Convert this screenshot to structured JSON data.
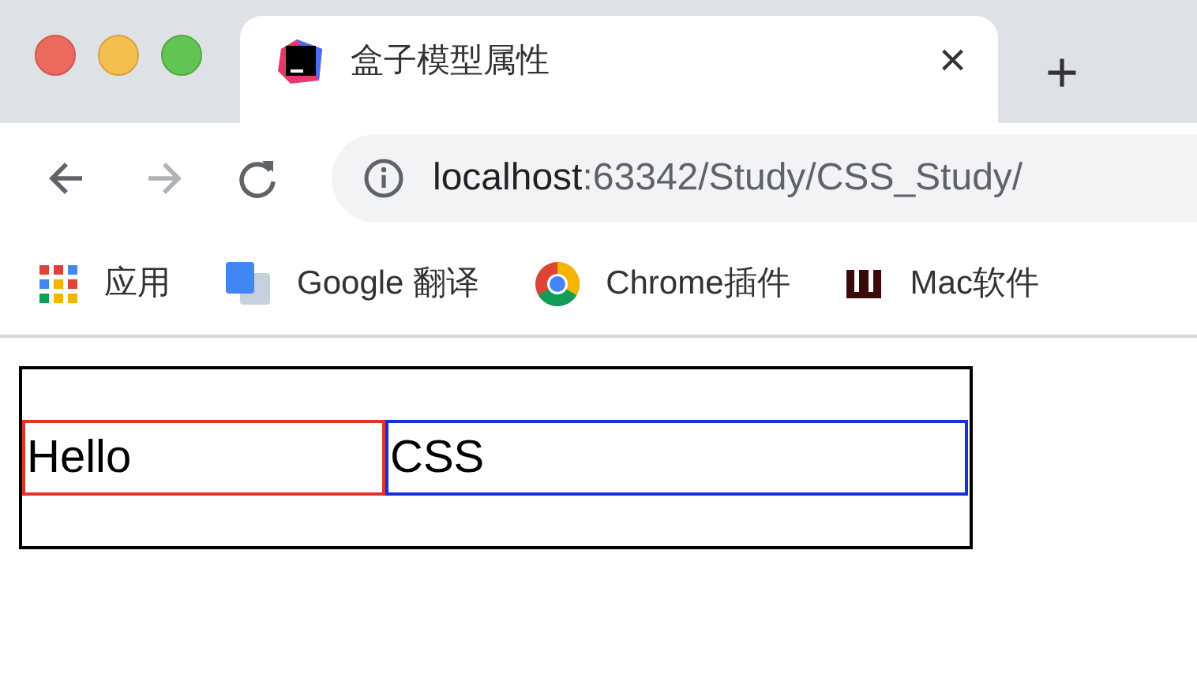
{
  "window": {
    "controls": [
      {
        "kind": "close"
      },
      {
        "kind": "minimize"
      },
      {
        "kind": "zoom"
      }
    ]
  },
  "tabs": [
    {
      "title": "盒子模型属性",
      "close": "×",
      "selected": true
    }
  ],
  "new_tab": "+",
  "toolbar": {
    "back_enabled": true,
    "forward_enabled": false,
    "address": {
      "host": "localhost",
      "path": ":63342/Study/CSS_Study/"
    }
  },
  "bookmarks": [
    {
      "kind": "apps",
      "label": "应用"
    },
    {
      "kind": "translate",
      "label": "Google 翻译"
    },
    {
      "kind": "chrome",
      "label": "Chrome插件"
    },
    {
      "kind": "w",
      "label": "Mac软件"
    }
  ],
  "page": {
    "boxes": [
      {
        "text": "Hello",
        "color": "#e0332b"
      },
      {
        "text": "CSS",
        "color": "#1a2fd6"
      }
    ]
  }
}
